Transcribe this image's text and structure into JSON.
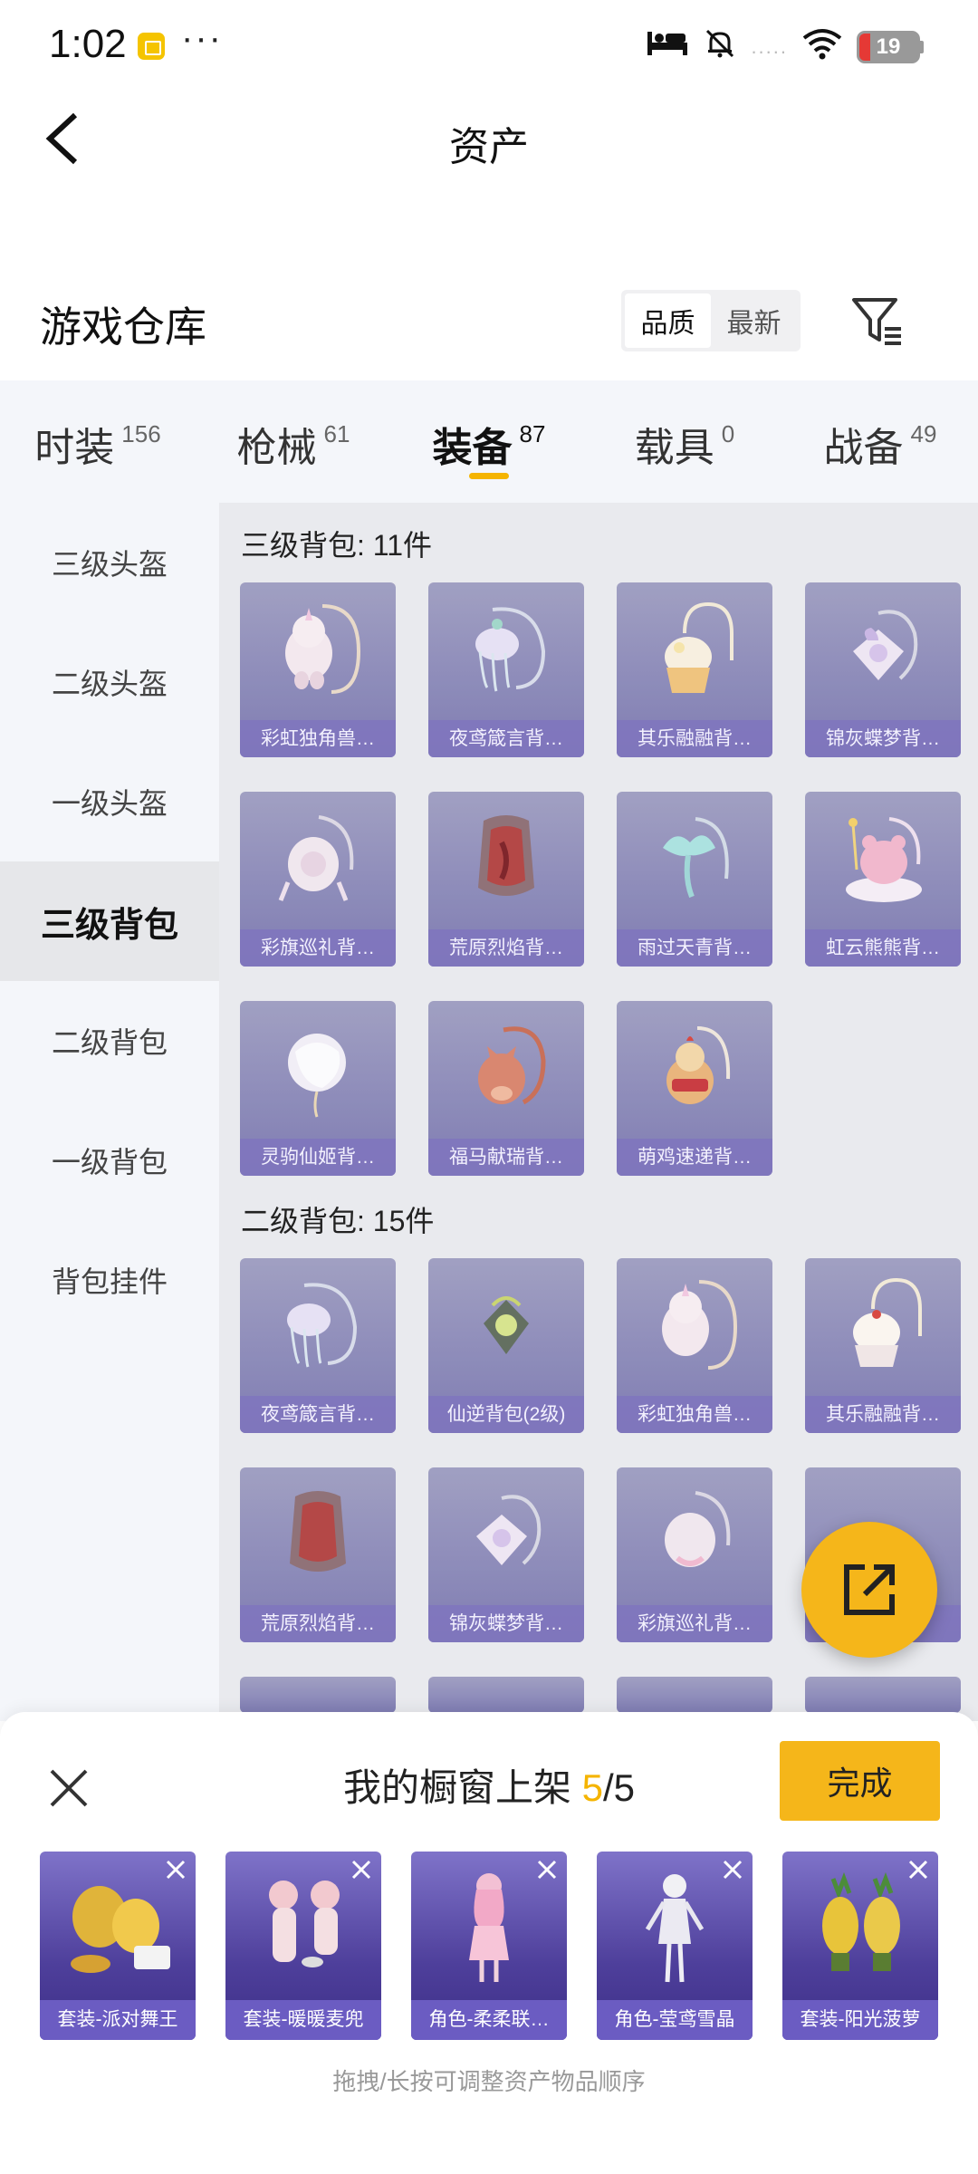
{
  "status_bar": {
    "time": "1:02",
    "more": "···",
    "battery": "19",
    "battery_level": 0.19,
    "dots": "....."
  },
  "header": {
    "title": "资产"
  },
  "warehouse": {
    "title": "游戏仓库",
    "sort_options": [
      "品质",
      "最新"
    ],
    "active_sort": "品质"
  },
  "tabs": [
    {
      "label": "时装",
      "count": "156"
    },
    {
      "label": "枪械",
      "count": "61"
    },
    {
      "label": "装备",
      "count": "87"
    },
    {
      "label": "载具",
      "count": "0"
    },
    {
      "label": "战备",
      "count": "49"
    }
  ],
  "active_tab": "装备",
  "sidebar": {
    "items": [
      "三级头盔",
      "二级头盔",
      "一级头盔",
      "三级背包",
      "二级背包",
      "一级背包",
      "背包挂件"
    ],
    "active": "三级背包"
  },
  "sections": [
    {
      "title": "三级背包: 11件",
      "items": [
        "彩虹独角兽…",
        "夜鸢箴言背…",
        "其乐融融背…",
        "锦灰蝶梦背…",
        "彩旗巡礼背…",
        "荒原烈焰背…",
        "雨过天青背…",
        "虹云熊熊背…",
        "灵驹仙姬背…",
        "福马献瑞背…",
        "萌鸡速递背…"
      ]
    },
    {
      "title": "二级背包: 15件",
      "items": [
        "夜鸢箴言背…",
        "仙逆背包(2级)",
        "彩虹独角兽…",
        "其乐融融背…",
        "荒原烈焰背…",
        "锦灰蝶梦背…",
        "彩旗巡礼背…",
        ""
      ]
    }
  ],
  "showcase": {
    "title_prefix": "我的橱窗上架 ",
    "current": "5",
    "total": "/5",
    "done_label": "完成",
    "items": [
      "套装-派对舞王",
      "套装-暖暖麦兜",
      "角色-柔柔联…",
      "角色-莹鸢雪晶",
      "套装-阳光菠萝"
    ],
    "hint": "拖拽/长按可调整资产物品顺序"
  },
  "colors": {
    "accent": "#f5b400",
    "card": "#8a88b8",
    "card_label": "#6b5cc2"
  }
}
